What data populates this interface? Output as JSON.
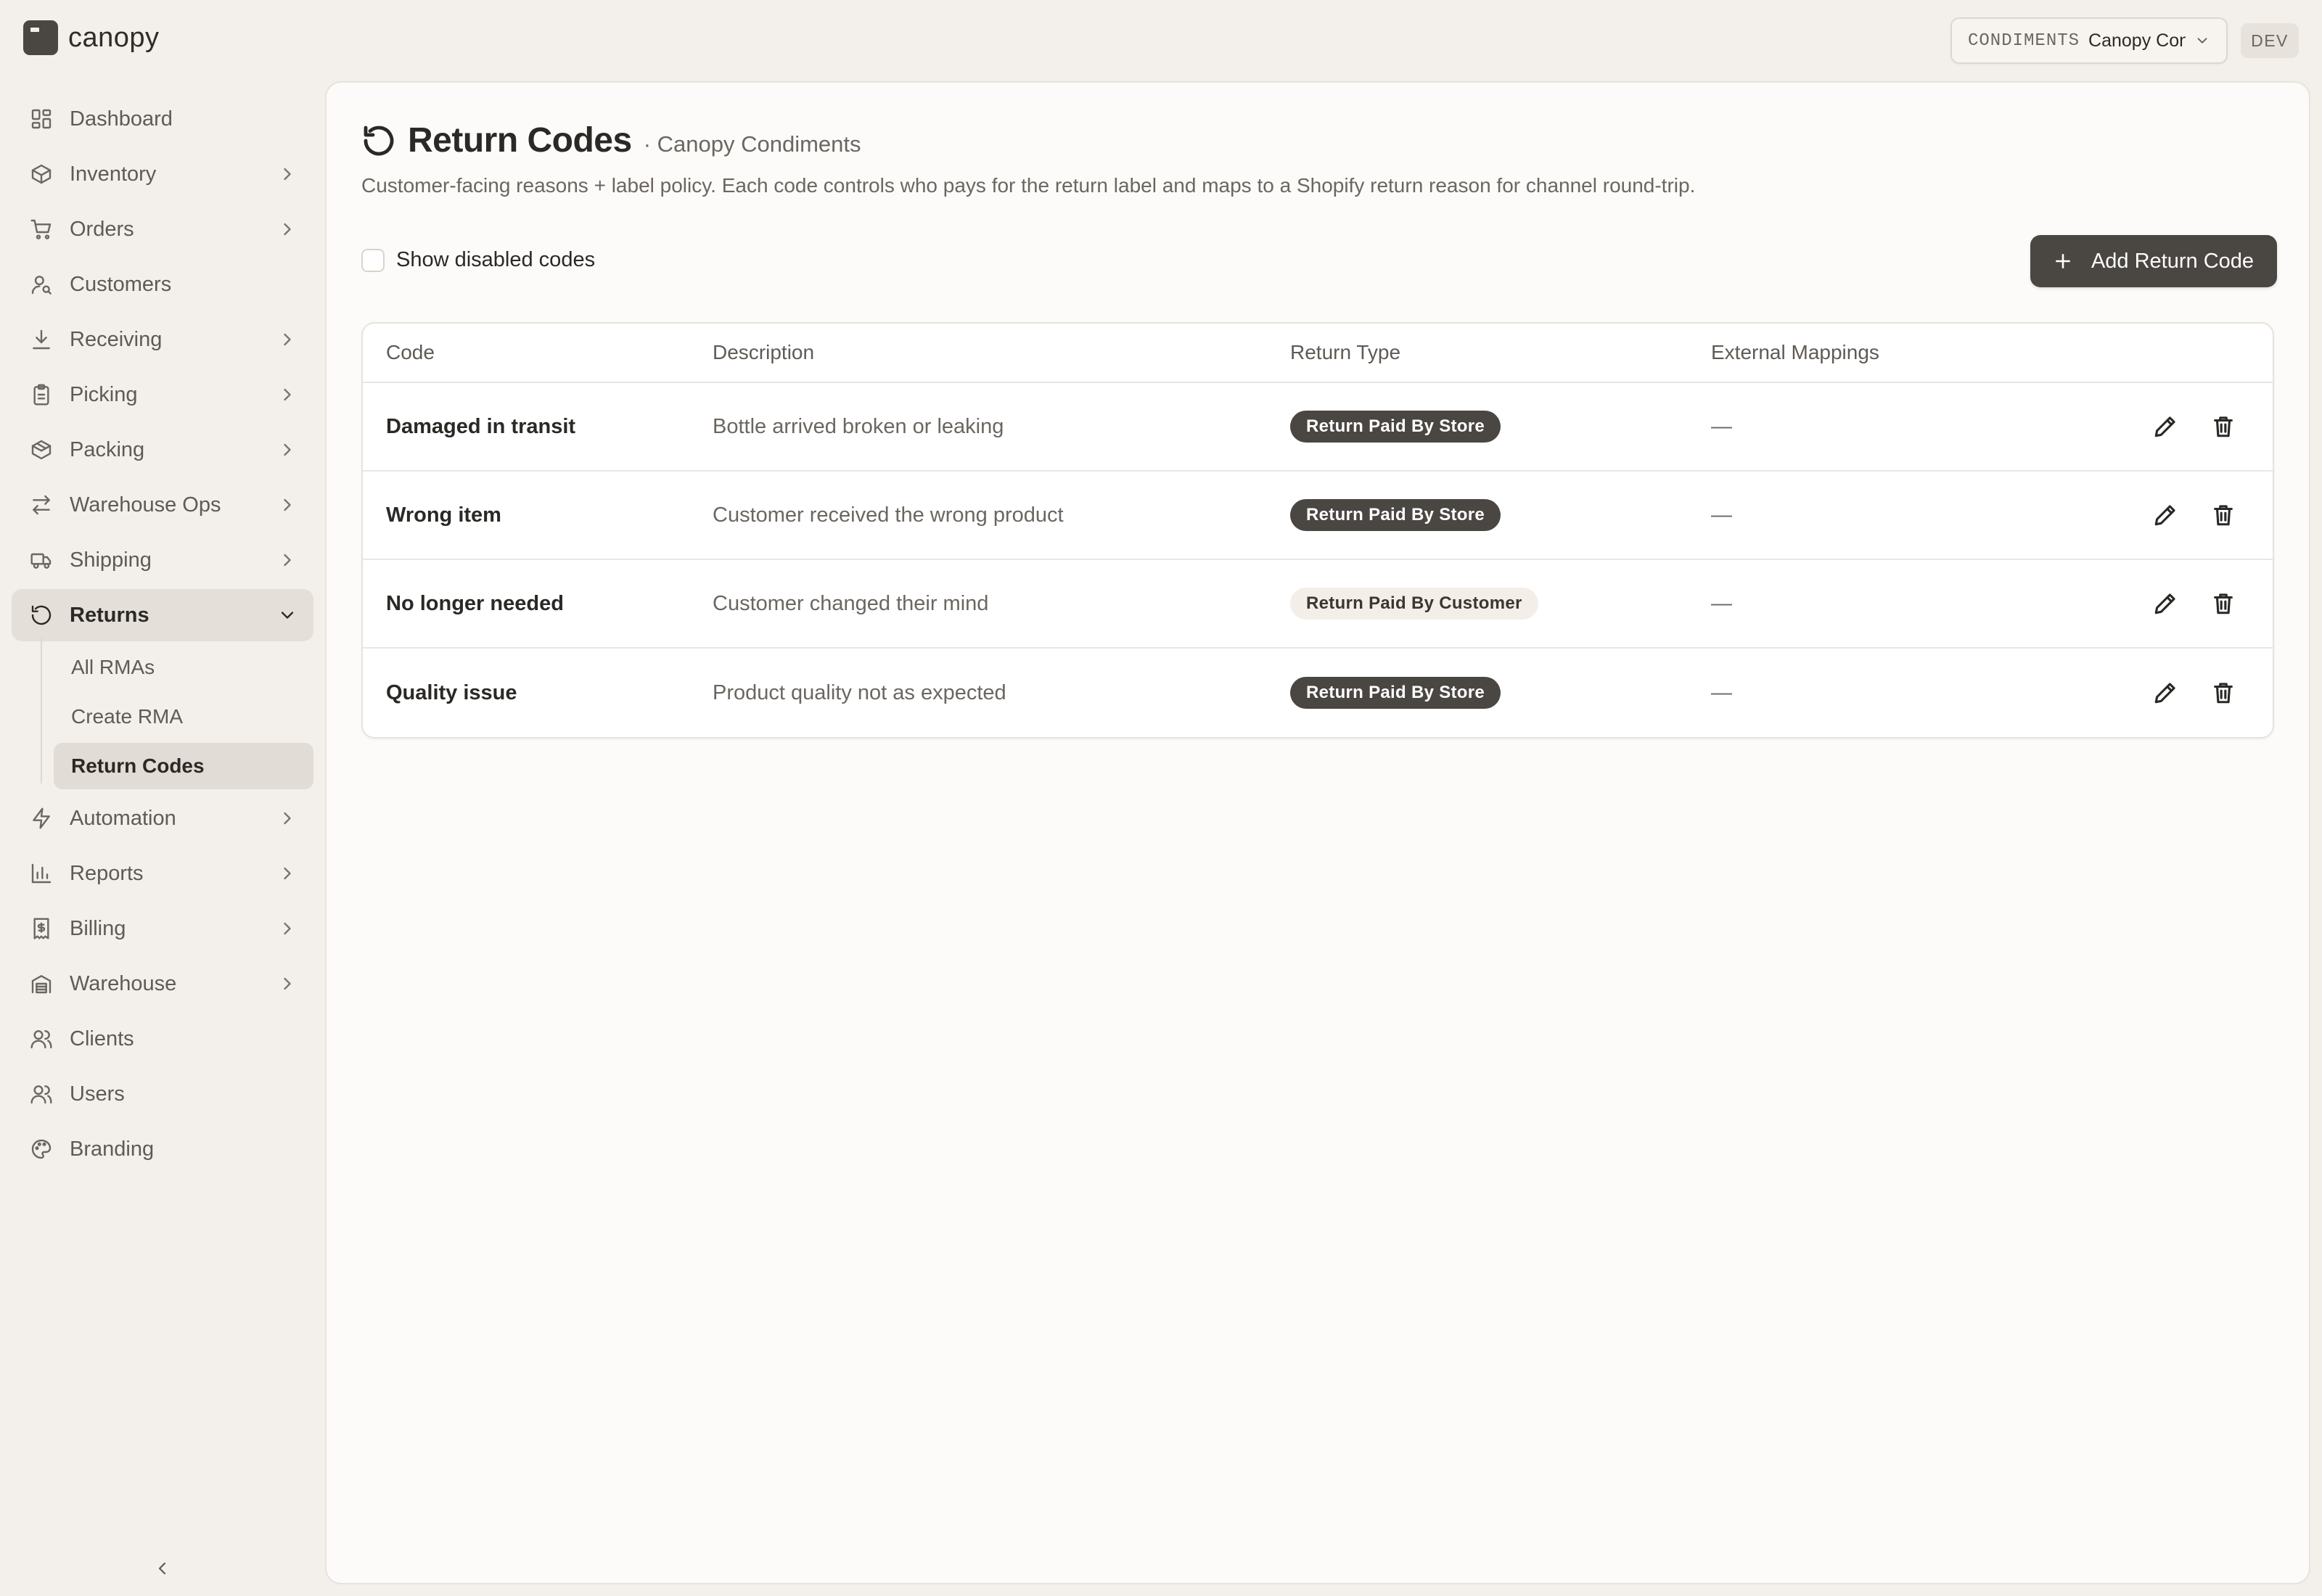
{
  "app": {
    "logo_text": "canopy"
  },
  "header": {
    "client_tag": "CONDIMENTS",
    "client_name": "Canopy Cond",
    "env_badge": "DEV"
  },
  "sidebar": {
    "items": [
      {
        "label": "Dashboard",
        "icon": "dashboard-icon",
        "has_arrow": false
      },
      {
        "label": "Inventory",
        "icon": "box-icon",
        "has_arrow": true
      },
      {
        "label": "Orders",
        "icon": "cart-icon",
        "has_arrow": true
      },
      {
        "label": "Customers",
        "icon": "user-search-icon",
        "has_arrow": false
      },
      {
        "label": "Receiving",
        "icon": "download-icon",
        "has_arrow": true
      },
      {
        "label": "Picking",
        "icon": "clipboard-icon",
        "has_arrow": true
      },
      {
        "label": "Packing",
        "icon": "package-icon",
        "has_arrow": true
      },
      {
        "label": "Warehouse Ops",
        "icon": "arrows-exchange-icon",
        "has_arrow": true
      },
      {
        "label": "Shipping",
        "icon": "truck-icon",
        "has_arrow": true
      },
      {
        "label": "Returns",
        "icon": "rotate-ccw-icon",
        "has_arrow": true,
        "expanded": true
      },
      {
        "label": "Automation",
        "icon": "lightning-icon",
        "has_arrow": true
      },
      {
        "label": "Reports",
        "icon": "bar-chart-icon",
        "has_arrow": true
      },
      {
        "label": "Billing",
        "icon": "receipt-icon",
        "has_arrow": true
      },
      {
        "label": "Warehouse",
        "icon": "warehouse-icon",
        "has_arrow": true
      },
      {
        "label": "Clients",
        "icon": "users-icon",
        "has_arrow": false
      },
      {
        "label": "Users",
        "icon": "users-icon",
        "has_arrow": false
      },
      {
        "label": "Branding",
        "icon": "palette-icon",
        "has_arrow": false
      }
    ],
    "returns_sub": [
      {
        "label": "All RMAs"
      },
      {
        "label": "Create RMA"
      },
      {
        "label": "Return Codes",
        "active": true
      }
    ]
  },
  "page": {
    "title": "Return Codes",
    "subtitle": "· Canopy Condiments",
    "description": "Customer-facing reasons + label policy. Each code controls who pays for the return label and maps to a Shopify return reason for channel round-trip.",
    "show_disabled_label": "Show disabled codes",
    "show_disabled_checked": false,
    "add_button_label": "Add Return Code"
  },
  "table": {
    "columns": [
      "Code",
      "Description",
      "Return Type",
      "External Mappings"
    ],
    "rows": [
      {
        "code": "Damaged in transit",
        "description": "Bottle arrived broken or leaking",
        "return_type": "Return Paid By Store",
        "badge_style": "dark",
        "external": "—"
      },
      {
        "code": "Wrong item",
        "description": "Customer received the wrong product",
        "return_type": "Return Paid By Store",
        "badge_style": "dark",
        "external": "—"
      },
      {
        "code": "No longer needed",
        "description": "Customer changed their mind",
        "return_type": "Return Paid By Customer",
        "badge_style": "light",
        "external": "—"
      },
      {
        "code": "Quality issue",
        "description": "Product quality not as expected",
        "return_type": "Return Paid By Store",
        "badge_style": "dark",
        "external": "—"
      }
    ]
  },
  "colors": {
    "background": "#f3efea",
    "panel": "#fcfbf9",
    "accent_dark": "#4a4642",
    "badge_light": "#f3eee8"
  }
}
